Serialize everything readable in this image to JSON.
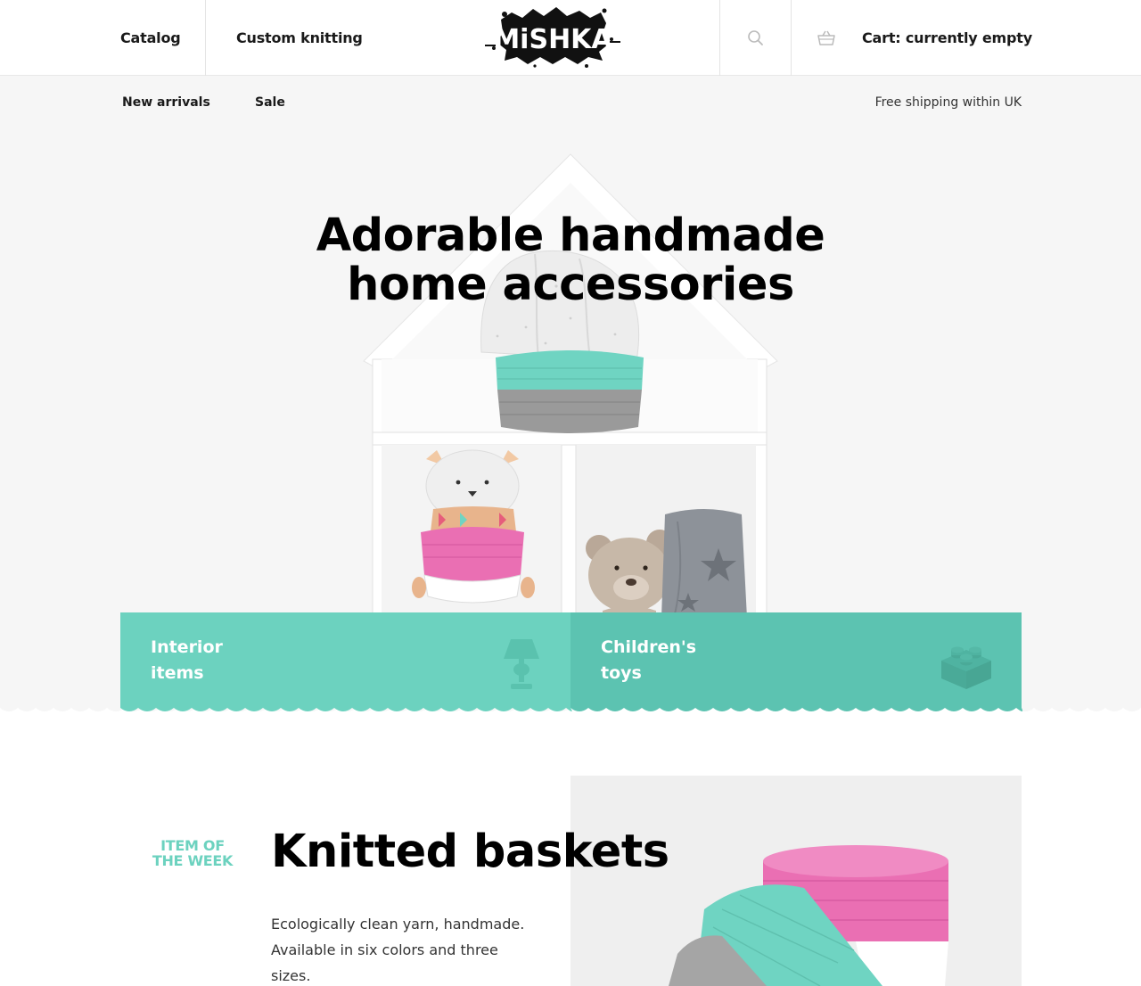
{
  "header": {
    "nav": [
      {
        "label": "Catalog"
      },
      {
        "label": "Custom knitting"
      }
    ],
    "logo_text": "MiSHKA",
    "search_icon": "search-icon",
    "cart_icon": "basket-icon",
    "cart_label": "Cart: currently empty"
  },
  "subnav": {
    "items": [
      {
        "label": "New arrivals"
      },
      {
        "label": "Sale"
      }
    ],
    "shipping_note": "Free shipping within UK"
  },
  "hero": {
    "title_line1": "Adorable handmade",
    "title_line2": "home accessories"
  },
  "categories": [
    {
      "label_line1": "Interior",
      "label_line2": "items",
      "icon": "lamp-icon",
      "color": "#6cd2bf"
    },
    {
      "label_line1": "Children's",
      "label_line2": "toys",
      "icon": "toy-block-icon",
      "color": "#5cc3b1"
    }
  ],
  "week": {
    "kicker_line1": "Item of",
    "kicker_line2": "the week",
    "title": "Knitted baskets",
    "description": "Ecologically clean yarn, handmade. Available in six colors and three sizes."
  },
  "colors": {
    "accent": "#6cd2bf",
    "accent_dark": "#5cc3b1",
    "hero_bg": "#f6f6f6"
  }
}
